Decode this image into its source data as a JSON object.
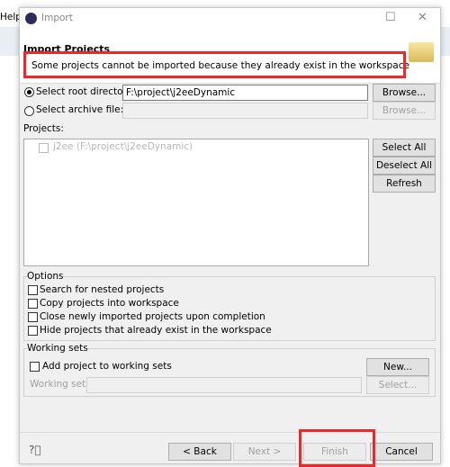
{
  "background": {
    "menu_help": "Help"
  },
  "window": {
    "title": "Import"
  },
  "header": {
    "title": "Import Projects",
    "message": "Some projects cannot be imported because they already exist in the workspace"
  },
  "source": {
    "root_label": "Select root directory:",
    "root_value": "F:\\project\\j2eeDynamic",
    "archive_label": "Select archive file:",
    "archive_value": "",
    "browse": "Browse...",
    "browse2": "Browse..."
  },
  "projects": {
    "label": "Projects:",
    "items": [
      {
        "label": "j2ee (F:\\project\\j2eeDynamic)",
        "checked": false,
        "enabled": false
      }
    ],
    "select_all": "Select All",
    "deselect_all": "Deselect All",
    "refresh": "Refresh"
  },
  "options": {
    "title": "Options",
    "items": [
      {
        "label": "Search for nested projects",
        "checked": false
      },
      {
        "label": "Copy projects into workspace",
        "checked": false
      },
      {
        "label": "Close newly imported projects upon completion",
        "checked": false
      },
      {
        "label": "Hide projects that already exist in the workspace",
        "checked": false
      }
    ]
  },
  "working_sets": {
    "title": "Working sets",
    "add_label": "Add project to working sets",
    "sets_label": "Working sets:",
    "new": "New...",
    "select": "Select..."
  },
  "footer": {
    "back": "< Back",
    "next": "Next >",
    "finish": "Finish",
    "cancel": "Cancel"
  },
  "colors": {
    "highlight": "#e52b2b"
  }
}
